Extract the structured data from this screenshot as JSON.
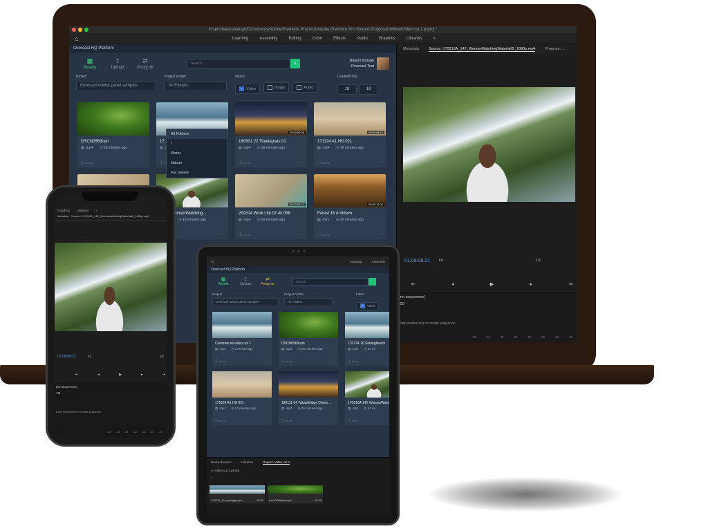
{
  "laptop": {
    "window_title": "/Users/balazsbalogh/Documents/Adobe/Premiere Pro/14.0/Adobe Premiere Pro Shared Projects/Untitled/Video cut 1.prproj *",
    "home_icon": "home-icon",
    "workspaces": [
      "Learning",
      "Assembly",
      "Editing",
      "Color",
      "Effects",
      "Audio",
      "Graphics",
      "Libraries",
      "»"
    ],
    "panel": {
      "title": "Overcast HQ Platform",
      "nav": [
        {
          "label": "Assets",
          "icon": "assets-icon",
          "active": true
        },
        {
          "label": "Upload",
          "icon": "upload-icon",
          "active": false
        },
        {
          "label": "Proxy off",
          "icon": "proxy-icon",
          "active": false
        }
      ],
      "search_placeholder": "Search...",
      "user_name": "Balazs Balogh",
      "user_org": "Overcast Test",
      "project_label": "Project",
      "project_value": "Overcast Adobe panel samples",
      "folder_label": "Project Folder",
      "folder_value": "All Folders",
      "filters_label": "Filters",
      "filters": [
        {
          "label": "Video",
          "checked": true
        },
        {
          "label": "Image",
          "checked": false
        },
        {
          "label": "Audio",
          "checked": false
        }
      ],
      "loaded_label": "Loaded/Total",
      "loaded": "19",
      "total": "19",
      "folder_dropdown": [
        "All Folders",
        "/",
        "Water",
        "Nature",
        "For review"
      ],
      "assets": [
        {
          "title": "DSCN0569rain",
          "ext": ".mp4",
          "time": "18 minutes ago",
          "scene": "sc-leaf",
          "dur": ""
        },
        {
          "title": "17...",
          "ext": ".m",
          "time": "",
          "scene": "sc-sea",
          "dur": ""
        },
        {
          "title": "180301 22 Timelapses 01",
          "ext": ".mp4",
          "time": "18 minutes ago",
          "scene": "sc-city",
          "dur": "00:00:06:06"
        },
        {
          "title": "171124 A1 HD 021",
          "ext": ".mp4",
          "time": "19 minutes ago",
          "scene": "sc-sand",
          "dur": "00:00:08:10"
        },
        {
          "title": "",
          "ext": "",
          "time": "",
          "scene": "sc-beige",
          "dur": ""
        },
        {
          "title": "A 142 WomanWatching...",
          "ext": ".mp4",
          "time": "19 minutes ago",
          "scene": "sc-waterfall",
          "dur": ""
        },
        {
          "title": "200314 Work Life 02 4k 058",
          "ext": ".mp4",
          "time": "19 minutes ago",
          "scene": "sc-work",
          "dur": "00:00:07:12"
        },
        {
          "title": "Forest 15 4 Videvo",
          "ext": ".mov",
          "time": "20 minutes ago",
          "scene": "sc-forest",
          "dur": "00:00:12:00"
        }
      ]
    },
    "right": {
      "tabs": [
        "Metadata",
        "Source: 170216A_142_WomanWatchingWaterfall2_1080p.mp4",
        "Program: ..."
      ],
      "timecode": "01:08:08:21",
      "fit": "Fit",
      "scale": "1/2",
      "transport": [
        "⇤",
        "◂",
        "▶",
        "▸",
        "⇥"
      ],
      "sequence_title": "(no sequences)",
      "sequence_time": ":00",
      "sequence_text": "Drop media here to create sequence.",
      "meter": [
        "-48",
        "-54",
        "-48",
        "-42",
        "-36",
        "-30",
        "-24",
        "-18"
      ]
    }
  },
  "phone": {
    "tabs": [
      "Graphics",
      "Libraries",
      "»"
    ],
    "source": "Source: 170216A_142_WomanWatchingWaterfall2_1080p.mp4",
    "metadata": "Metadata",
    "timecode": "01:08:08:21",
    "fit": "Fit",
    "scale": "1/2",
    "sequence_title": "(no sequences)",
    "sequence_time": ":00",
    "sequence_text": "Drop media here to create sequence.",
    "meter": [
      "-48",
      "-54",
      "-48",
      "-42",
      "-36",
      "-30",
      "-24"
    ]
  },
  "tablet": {
    "workspaces": [
      "Learning",
      "Assembly"
    ],
    "panel_title": "Overcast HQ Platform",
    "nav": [
      {
        "label": "Assets",
        "active": true
      },
      {
        "label": "Upload",
        "active": false
      },
      {
        "label": "Proxy on",
        "active": false
      }
    ],
    "search_placeholder": "Search...",
    "project_label": "Project",
    "project_value": "Overcast Adobe panel samples",
    "folder_label": "Project Folder",
    "folder_value": "All Folders",
    "filters_label": "Filters",
    "filter_video": "Video",
    "assets": [
      {
        "title": "Commercial video cut 1",
        "ext": ".mp4",
        "time": "a minute ago",
        "scene": "sc-sea"
      },
      {
        "title": "DSCN0569rain",
        "ext": ".mp4",
        "time": "23 minutes ago",
        "scene": "sc-leaf"
      },
      {
        "title": "170724 10 Selangbeach",
        "ext": ".mp4",
        "time": "24 mi",
        "scene": "sc-sea"
      },
      {
        "title": "171124 A1 HD 021",
        "ext": ".mp4",
        "time": "24 minutes ago",
        "scene": "sc-sand"
      },
      {
        "title": "180111 04 TakabBridge Drone ...",
        "ext": ".mp4",
        "time": "24 minutes ago",
        "scene": "sc-city"
      },
      {
        "title": "170216A 142 WomanWatchi",
        "ext": ".mp4",
        "time": "24 mi",
        "scene": "sc-waterfall"
      }
    ],
    "bottom_tabs": [
      "Media Browser",
      "Libraries",
      "Project: Video cut 1"
    ],
    "project_file": "Video cut 1.prproj",
    "bins": [
      {
        "name": "170734_10_selangbeach...",
        "dur": "20:22"
      },
      {
        "name": "dscn0569rain.mp4",
        "dur": "19:30"
      }
    ]
  }
}
